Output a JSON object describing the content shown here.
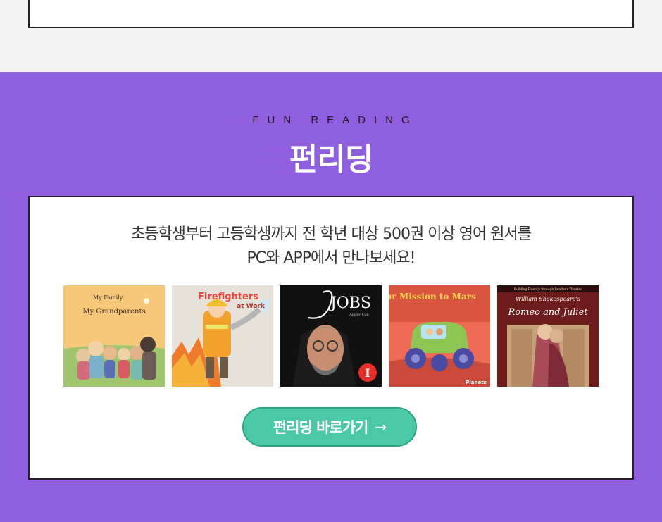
{
  "section": {
    "eyebrow": "FUN READING",
    "title": "펀리딩",
    "description_line1": "초등학생부터 고등학생까지 전 학년 대상 500권 이상 영어 원서를",
    "description_line2": "PC와 APP에서 만나보세요!",
    "cta_label": "펀리딩 바로가기",
    "cta_arrow": "→"
  },
  "books": [
    {
      "title_small": "My Family",
      "title_main": "My Grandparents"
    },
    {
      "title_main": "Firefighters",
      "title_sub": "at Work"
    },
    {
      "title_main": "JOBS",
      "subtitle": "Apple•Con",
      "badge": "I"
    },
    {
      "title_main": "Your Mission to Mars",
      "brand": "Planets"
    },
    {
      "series": "Building Fluency through Reader's Theater",
      "title_small": "William Shakespeare's",
      "title_main": "Romeo and Juliet"
    }
  ],
  "colors": {
    "section_bg": "#8f5fdf",
    "cta_bg": "#4bc9a7",
    "page_bg": "#f3f3f3"
  }
}
